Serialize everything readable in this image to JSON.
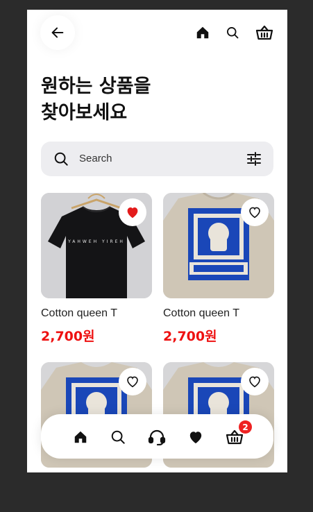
{
  "header": {
    "back_icon": "arrow-left-icon",
    "icons": [
      "home-icon",
      "search-icon",
      "basket-icon"
    ]
  },
  "headline": {
    "line1": "원하는 상품을",
    "line2": "찾아보세요"
  },
  "search": {
    "placeholder": "Search",
    "search_icon": "search-icon",
    "filter_icon": "sliders-icon"
  },
  "products": [
    {
      "name": "Cotton queen T",
      "price": "2,700원",
      "favorited": true,
      "shirt": "black tee with print YAHWEH YIREH",
      "shirt_print": "YAHWEH YIREH"
    },
    {
      "name": "Cotton queen T",
      "price": "2,700원",
      "favorited": false,
      "shirt": "beige tee with blue cat print"
    },
    {
      "name": "",
      "price": "",
      "favorited": false,
      "shirt": "beige tee with blue cat print"
    },
    {
      "name": "",
      "price": "",
      "favorited": false,
      "shirt": "beige tee with blue cat print"
    }
  ],
  "bottom_nav": {
    "items": [
      "home-icon",
      "search-icon",
      "headset-icon",
      "heart-icon",
      "basket-icon"
    ],
    "cart_count": "2"
  },
  "colors": {
    "price": "#ee1111",
    "heart_active": "#e31b1b",
    "badge": "#ee2222",
    "shirt_print_blue": "#1a47b8",
    "background": "#2b2b2b"
  }
}
